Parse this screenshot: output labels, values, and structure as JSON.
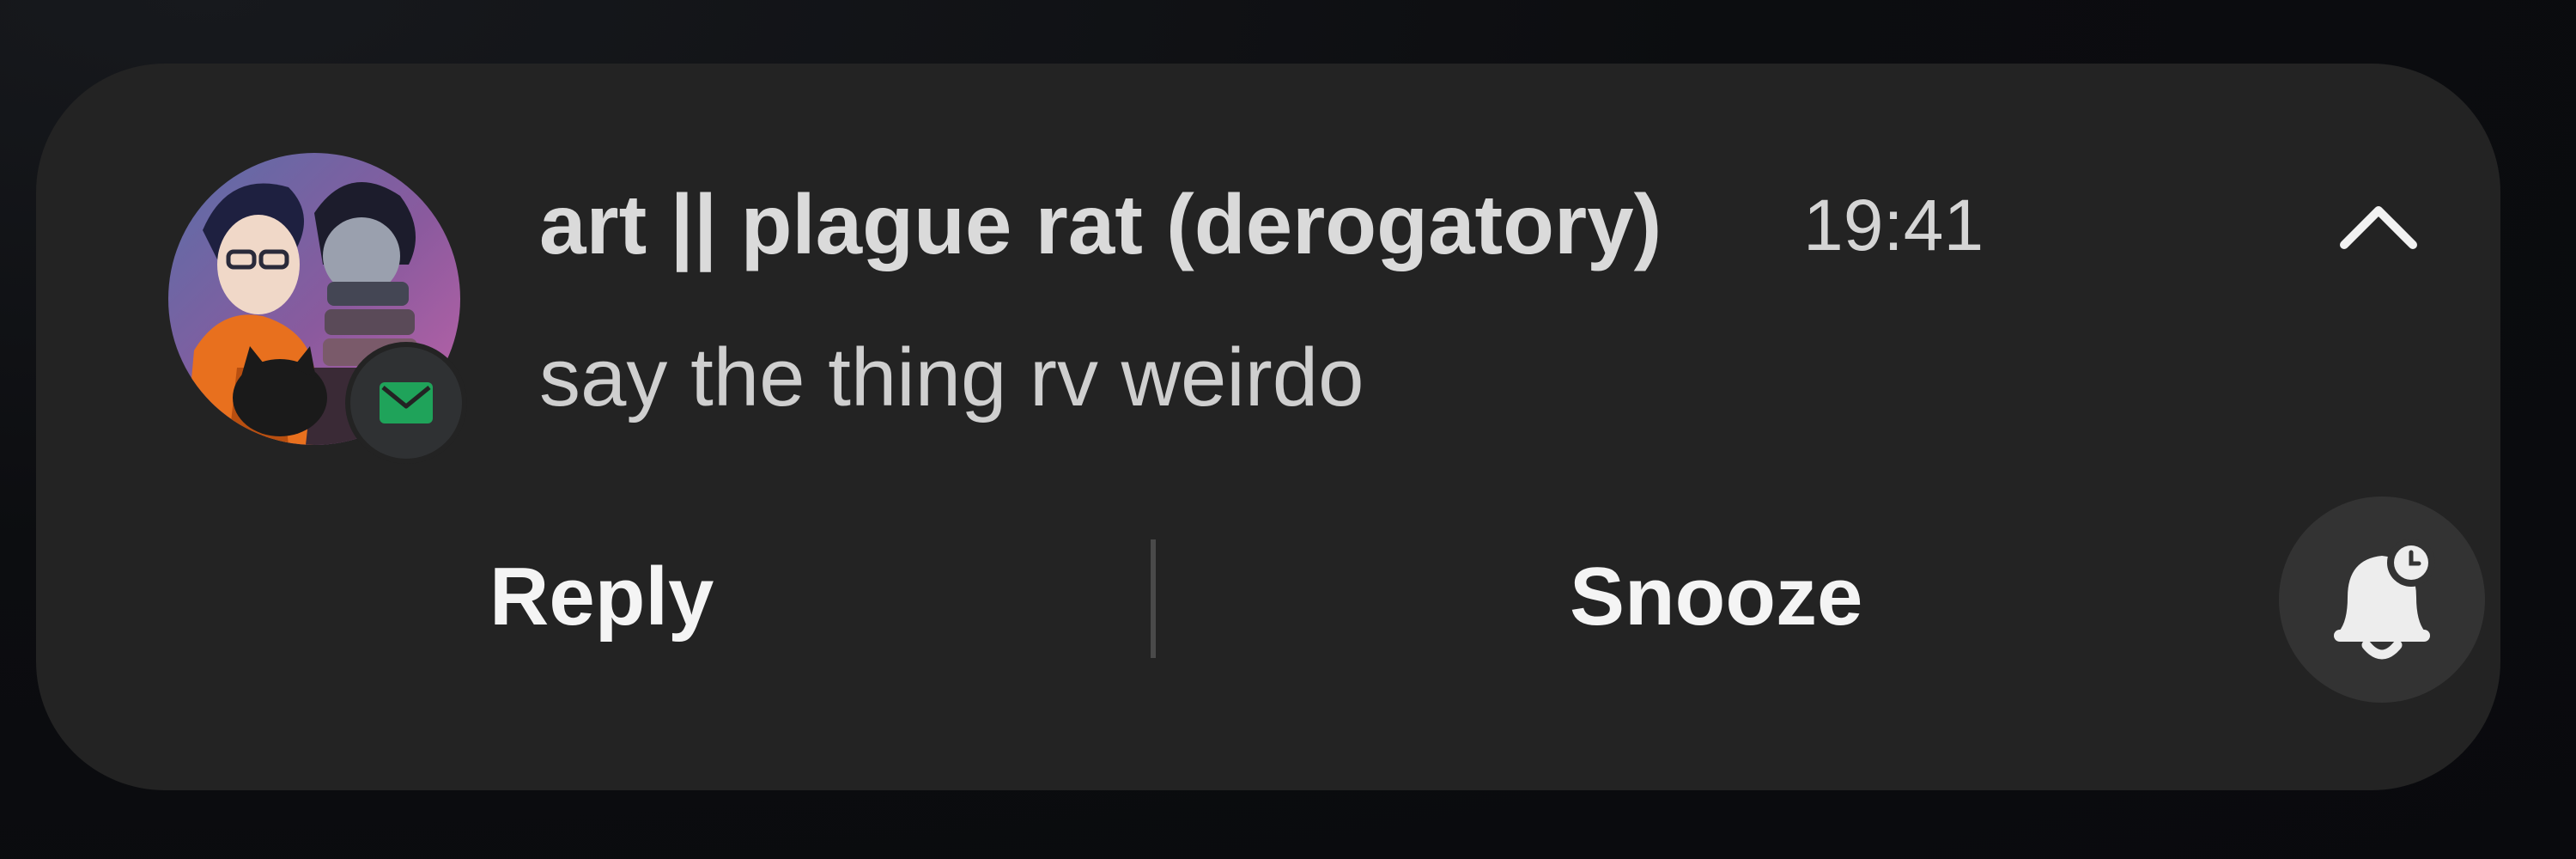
{
  "notification": {
    "title": "art || plague rat (derogatory)",
    "time": "19:41",
    "message": "say the thing rv weirdo",
    "avatar_icon": "group-avatar-icon",
    "app_badge_icon": "envelope-icon",
    "collapse_icon": "chevron-up-icon"
  },
  "actions": {
    "reply_label": "Reply",
    "snooze_label": "Snooze",
    "snooze_icon": "bell-clock-icon"
  },
  "colors": {
    "card_background": "#232323",
    "badge_accent": "#1fa35a",
    "text_primary": "#f4f4f4",
    "text_secondary": "#d5d5d5"
  }
}
